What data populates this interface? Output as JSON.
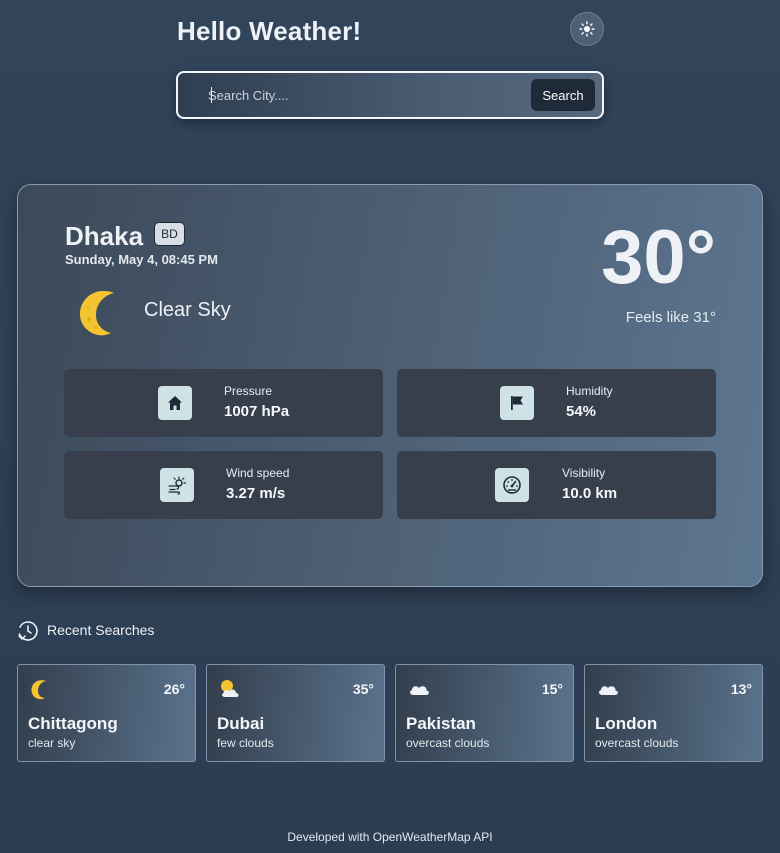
{
  "header": {
    "title": "Hello Weather!",
    "theme_toggle_icon": "sun-icon"
  },
  "search": {
    "value": "",
    "placeholder": "Search City....",
    "button_label": "Search"
  },
  "current": {
    "city": "Dhaka",
    "country": "BD",
    "datetime": "Sunday, May 4, 08:45 PM",
    "condition": "Clear Sky",
    "condition_icon": "moon-icon",
    "temperature": "30°",
    "feels_like": "Feels like 31°",
    "stats": [
      {
        "label": "Pressure",
        "value": "1007 hPa",
        "icon": "home-icon"
      },
      {
        "label": "Humidity",
        "value": "54%",
        "icon": "flag-icon"
      },
      {
        "label": "Wind speed",
        "value": "3.27 m/s",
        "icon": "wind-icon"
      },
      {
        "label": "Visibility",
        "value": "10.0 km",
        "icon": "gauge-icon"
      }
    ]
  },
  "recent": {
    "title": "Recent Searches",
    "icon": "history-icon",
    "items": [
      {
        "city": "Chittagong",
        "temp": "26°",
        "desc": "clear sky",
        "icon": "moon-icon"
      },
      {
        "city": "Dubai",
        "temp": "35°",
        "desc": "few clouds",
        "icon": "sun-cloud-icon"
      },
      {
        "city": "Pakistan",
        "temp": "15°",
        "desc": "overcast clouds",
        "icon": "cloud-icon"
      },
      {
        "city": "London",
        "temp": "13°",
        "desc": "overcast clouds",
        "icon": "cloud-icon"
      }
    ]
  },
  "footer": {
    "text": "Developed with OpenWeatherMap API"
  },
  "colors": {
    "background": "#2e4054",
    "card_gradient_start": "#3b4958",
    "card_gradient_end": "#5d7690",
    "stat_tile": "#363f4b",
    "icon_tile": "#cfe3e7",
    "moon": "#f4c430",
    "search_button": "#1f2a38"
  }
}
